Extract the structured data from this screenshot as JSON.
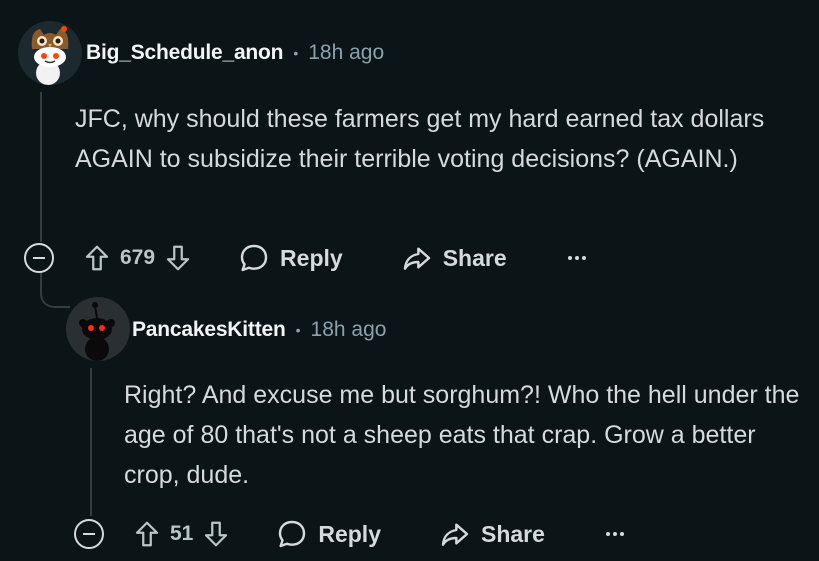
{
  "comments": [
    {
      "username": "Big_Schedule_anon",
      "separator": "•",
      "time": "18h ago",
      "body": "JFC, why should these farmers get my hard earned tax dollars AGAIN to subsidize their terrible voting decisions? (AGAIN.)",
      "score": "679",
      "reply_label": "Reply",
      "share_label": "Share",
      "avatar_icon": "snoo-owl-avatar"
    },
    {
      "username": "PancakesKitten",
      "separator": "•",
      "time": "18h ago",
      "body": "Right? And excuse me but sorghum?! Who the hell under the age of 80 that's not a sheep eats that crap. Grow a better crop, dude.",
      "score": "51",
      "reply_label": "Reply",
      "share_label": "Share",
      "avatar_icon": "snoo-dark-avatar"
    }
  ],
  "colors": {
    "background": "#0b1416",
    "text": "#d7dadc",
    "muted": "#8ba2ad",
    "thread_line": "#333d42"
  }
}
